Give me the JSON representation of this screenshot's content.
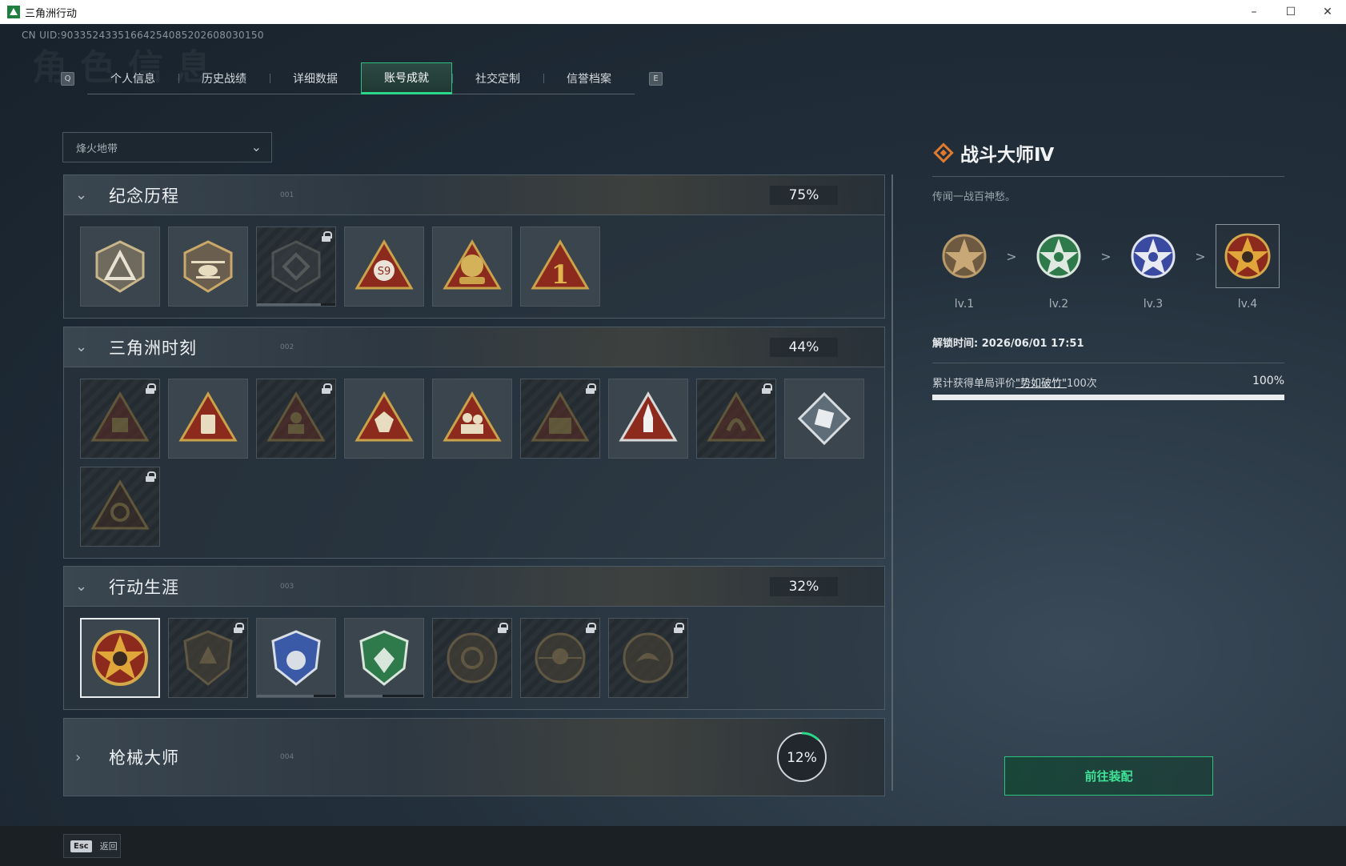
{
  "window": {
    "title": "三角洲行动",
    "controls": [
      "–",
      "☐",
      "✕"
    ]
  },
  "uid": "CN UID:903352433516642540852026080301​50",
  "ghost_title": "角色信息",
  "tabs": {
    "left_key": "Q",
    "right_key": "E",
    "items": [
      "个人信息",
      "历史战绩",
      "详细数据",
      "账号成就",
      "社交定制",
      "信誉档案"
    ],
    "active_index": 3
  },
  "mode_select": {
    "value": "烽火地带"
  },
  "sections": [
    {
      "title": "纪念历程",
      "code": "001",
      "percent": "75%",
      "expanded": true
    },
    {
      "title": "三角洲时刻",
      "code": "002",
      "percent": "44%",
      "expanded": true
    },
    {
      "title": "行动生涯",
      "code": "003",
      "percent": "32%",
      "expanded": true
    },
    {
      "title": "枪械大师",
      "code": "004",
      "percent": "12%",
      "progress": 0.12,
      "expanded": false
    }
  ],
  "detail": {
    "title": "战斗大师Ⅳ",
    "description": "传闻一战百神愁。",
    "levels": [
      "lv.1",
      "lv.2",
      "lv.3",
      "lv.4"
    ],
    "current_level_index": 3,
    "separator": ">",
    "unlock_time": "解锁时间: 2026/06/01 17:51",
    "requirement_prefix": "累计获得单局评价",
    "requirement_link": "\"势如破竹\"",
    "requirement_suffix": "100次",
    "requirement_percent": "100%",
    "requirement_progress": 1.0,
    "equip_button": "前往装配"
  },
  "footer": {
    "esc_key": "Esc",
    "esc_label": "返回"
  },
  "colors": {
    "accent_green": "#2bd88a",
    "badge_gold": "#c9a24a",
    "badge_red": "#8c2a1e"
  }
}
